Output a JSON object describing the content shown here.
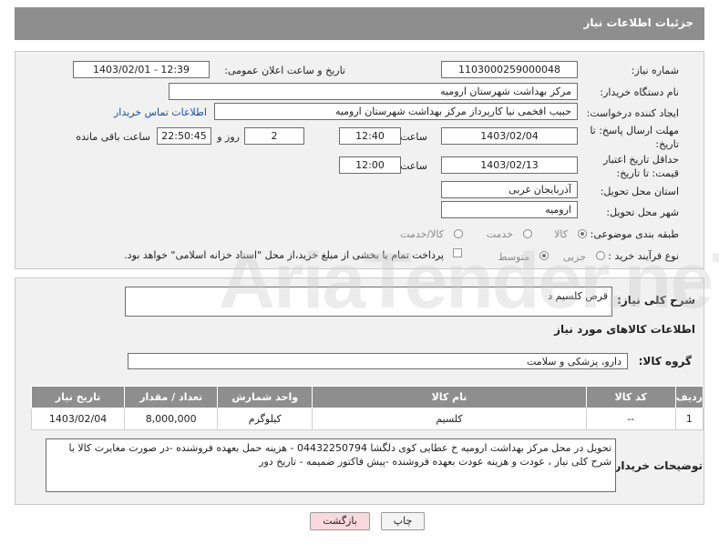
{
  "page": {
    "title": "جزئیات اطلاعات نیاز"
  },
  "need": {
    "number_label": "شماره نیاز:",
    "number_value": "1103000259000048",
    "announce_label": "تاریخ و ساعت اعلان عمومی:",
    "announce_value": "1403/02/01 - 12:39",
    "buyer_label": "نام دستگاه خریدار:",
    "buyer_value": "مرکز بهداشت شهرستان ارومیه",
    "creator_label": "ایجاد کننده درخواست:",
    "creator_value": "حبیب افخمی نیا کارپرداز مرکز بهداشت شهرستان ارومیه",
    "contact_link": "اطلاعات تماس خریدار",
    "deadline_label": "مهلت ارسال پاسخ: تا تاریخ:",
    "deadline_date": "1403/02/04",
    "time_label": "ساعت",
    "deadline_time": "12:40",
    "days_value": "2",
    "days_label": "روز و",
    "remaining_value": "22:50:45",
    "remaining_label": "ساعت باقی مانده",
    "validity_label": "حداقل تاریخ اعتبار قیمت: تا تاریخ:",
    "validity_date": "1403/02/13",
    "validity_time": "12:00",
    "province_label": "استان محل تحویل:",
    "province_value": "آذربایجان غربی",
    "city_label": "شهر محل تحویل:",
    "city_value": "ارومیه",
    "category_label": "طبقه بندی موضوعی:",
    "category_options": [
      "کالا",
      "خدمت",
      "کالا/خدمت"
    ],
    "category_selected": "کالا",
    "process_label": "نوع فرآیند خرید :",
    "process_options": [
      "جزیی",
      "متوسط"
    ],
    "payment_note": "پرداخت تمام یا بخشی از مبلغ خرید،از محل \"اسناد خزانه اسلامی\" خواهد بود."
  },
  "details": {
    "summary_label": "شرح کلی نیاز:",
    "summary_value": "قرص کلسیم د",
    "goods_info_title": "اطلاعات کالاهای مورد نیاز",
    "group_label": "گروه کالا:",
    "group_value": "دارو، پزشکی و سلامت",
    "table_headers": [
      "ردیف",
      "کد کالا",
      "نام کالا",
      "واحد شمارش",
      "تعداد / مقدار",
      "تاریخ نیاز"
    ],
    "rows": [
      {
        "row": "1",
        "code": "--",
        "name": "کلسیم",
        "unit": "کیلوگرم",
        "qty": "8,000,000",
        "date": "1403/02/04"
      }
    ],
    "buyer_notes_label": "توضیحات خریدار:",
    "buyer_notes_value": "تحویل در محل مرکز بهداشت ارومیه خ عطایی کوی دلگشا 04432250794 - هزینه حمل بعهده فروشنده -در صورت مغایرت کالا با شرح کلی نیاز ، عودت و هزینه عودت بعهده فروشنده -پیش فاکتور ضمیمه - تاریخ دور"
  },
  "actions": {
    "print_label": "چاپ",
    "back_label": "بازگشت"
  },
  "watermark": {
    "text": "AriaTender.neT"
  },
  "colors": {
    "header_bg": "#8e8e8e",
    "panel_bg": "#f1f1f1",
    "link": "#1a4fa3",
    "back_button_bg": "#f9d9dc"
  }
}
